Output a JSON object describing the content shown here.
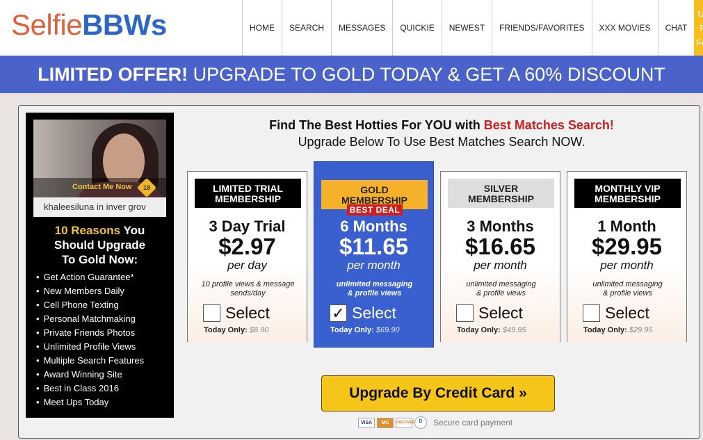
{
  "header": {
    "logo_part1": "Selfie",
    "logo_part2": "BBWs",
    "nav": [
      "HOME",
      "SEARCH",
      "MESSAGES",
      "QUICKIE",
      "NEWEST",
      "FRIENDS/FAVORITES",
      "XXX MOVIES",
      "CHAT"
    ],
    "upgrade_line1": "Upgrade",
    "upgrade_line2": "For Full",
    "upgrade_line3": "Features!"
  },
  "banner": {
    "bold": "LIMITED OFFER!",
    "rest": " UPGRADE TO GOLD TODAY & GET A 60% DISCOUNT"
  },
  "profile": {
    "contact": "Contact Me Now",
    "username": "khaleesiluna in inver grov"
  },
  "reasons": {
    "title_gold": "10 Reasons",
    "title_rest1": " You",
    "title_line2": "Should Upgrade",
    "title_line3": "To Gold Now:",
    "items": [
      "Get Action Guarantee*",
      "New Members Daily",
      "Cell Phone Texting",
      "Personal Matchmaking",
      "Private Friends Photos",
      "Unlimited Profile Views",
      "Multiple Search Features",
      "Award Winning Site",
      "Best in Class 2016",
      "Meet Ups Today"
    ]
  },
  "headline": {
    "text": "Find The Best Hotties For YOU with ",
    "red": "Best Matches Search!",
    "sub": "Upgrade Below To Use Best Matches Search NOW."
  },
  "plans": [
    {
      "label_line1": "LIMITED TRIAL",
      "label_line2": "MEMBERSHIP",
      "duration": "3 Day Trial",
      "price": "$2.97",
      "per": "per day",
      "desc_line1": "10 profile views & message",
      "desc_line2": "sends/day",
      "select": "Select",
      "today": "Today Only:",
      "old": "$8.90",
      "checked": false
    },
    {
      "label_line1": "GOLD",
      "label_line2": "MEMBERSHIP",
      "badge": "BEST DEAL",
      "duration": "6 Months",
      "price": "$11.65",
      "per": "per month",
      "desc_line1": "unlimited messaging",
      "desc_line2": "& profile views",
      "select": "Select",
      "today": "Today Only:",
      "old": "$69.90",
      "checked": true
    },
    {
      "label_line1": "SILVER",
      "label_line2": "MEMBERSHIP",
      "duration": "3 Months",
      "price": "$16.65",
      "per": "per month",
      "desc_line1": "unlimited messaging",
      "desc_line2": "& profile views",
      "select": "Select",
      "today": "Today Only:",
      "old": "$49.95",
      "checked": false
    },
    {
      "label_line1": "MONTHLY VIP",
      "label_line2": "MEMBERSHIP",
      "duration": "1 Month",
      "price": "$29.95",
      "per": "per month",
      "desc_line1": "unlimited messaging",
      "desc_line2": "& profile views",
      "select": "Select",
      "today": "Today Only:",
      "old": "$29.95",
      "checked": false
    }
  ],
  "cta": {
    "label": "Upgrade By Credit Card »"
  },
  "payment": {
    "cards": [
      "VISA",
      "MC",
      "DISCOVER",
      "D"
    ],
    "secure": "Secure card payment"
  }
}
